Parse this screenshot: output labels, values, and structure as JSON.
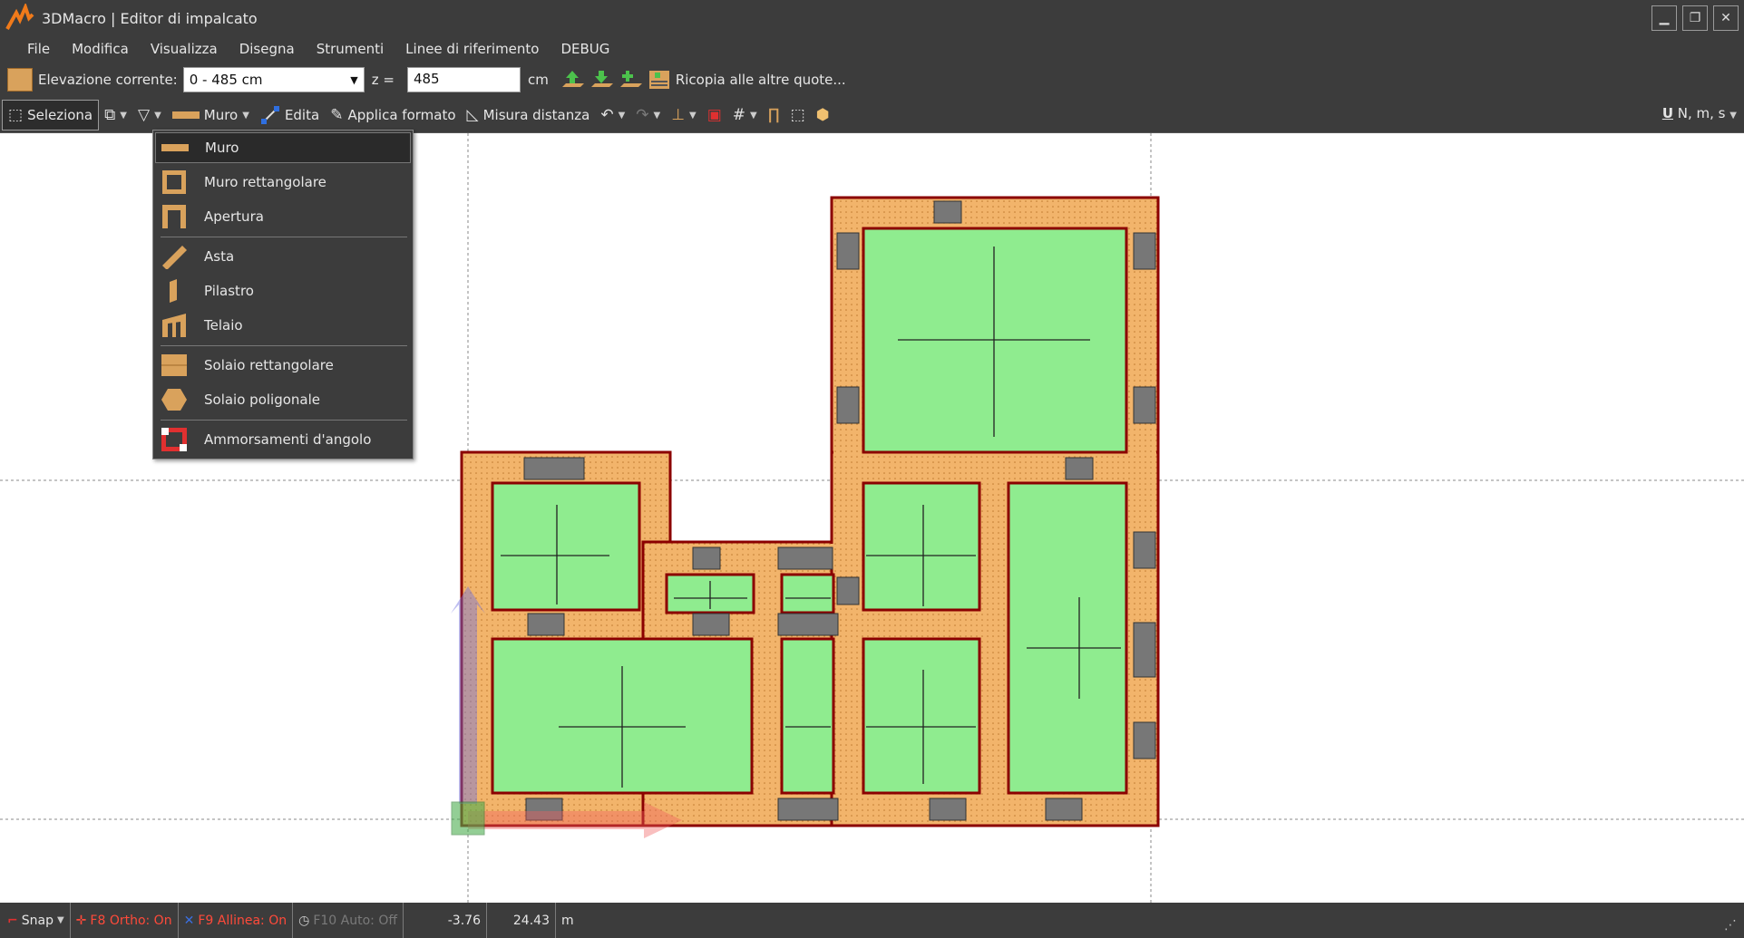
{
  "window": {
    "title": "3DMacro | Editor di impalcato",
    "min_glyph": "▁",
    "restore_glyph": "❐",
    "close_glyph": "✕"
  },
  "menu": [
    "File",
    "Modifica",
    "Visualizza",
    "Disegna",
    "Strumenti",
    "Linee di riferimento",
    "DEBUG"
  ],
  "toolbar1": {
    "elev_label": "Elevazione corrente:",
    "elev_value": "0 - 485 cm",
    "z_label": "z =",
    "z_value": "485",
    "unit": "cm",
    "copy_label": "Ricopia alle altre quote..."
  },
  "toolbar2": {
    "select_label": "Seleziona",
    "muro_label": "Muro",
    "edita_label": "Edita",
    "format_label": "Applica formato",
    "measure_label": "Misura distanza",
    "units_label": "N, m, s"
  },
  "dropdown": {
    "items": [
      {
        "label": "Muro",
        "icon": "wall-icon"
      },
      {
        "label": "Muro rettangolare",
        "icon": "rect-wall-icon"
      },
      {
        "label": "Apertura",
        "icon": "opening-icon"
      },
      {
        "label": "Asta",
        "icon": "beam-icon"
      },
      {
        "label": "Pilastro",
        "icon": "column-icon"
      },
      {
        "label": "Telaio",
        "icon": "frame-icon"
      },
      {
        "label": "Solaio rettangolare",
        "icon": "rect-slab-icon"
      },
      {
        "label": "Solaio poligonale",
        "icon": "poly-slab-icon"
      },
      {
        "label": "Ammorsamenti d'angolo",
        "icon": "corner-joint-icon"
      }
    ]
  },
  "status": {
    "snap": "Snap",
    "ortho": "F8 Ortho: On",
    "align": "F9 Allinea: On",
    "auto": "F10 Auto: Off",
    "x": "-3.76",
    "y": "24.43",
    "unit": "m"
  },
  "colors": {
    "chrome": "#3c3c3c",
    "wall_fill": "#f2b46b",
    "wall_border": "#8b0000",
    "slab_fill": "#8fec8f",
    "column_fill": "#777777"
  }
}
